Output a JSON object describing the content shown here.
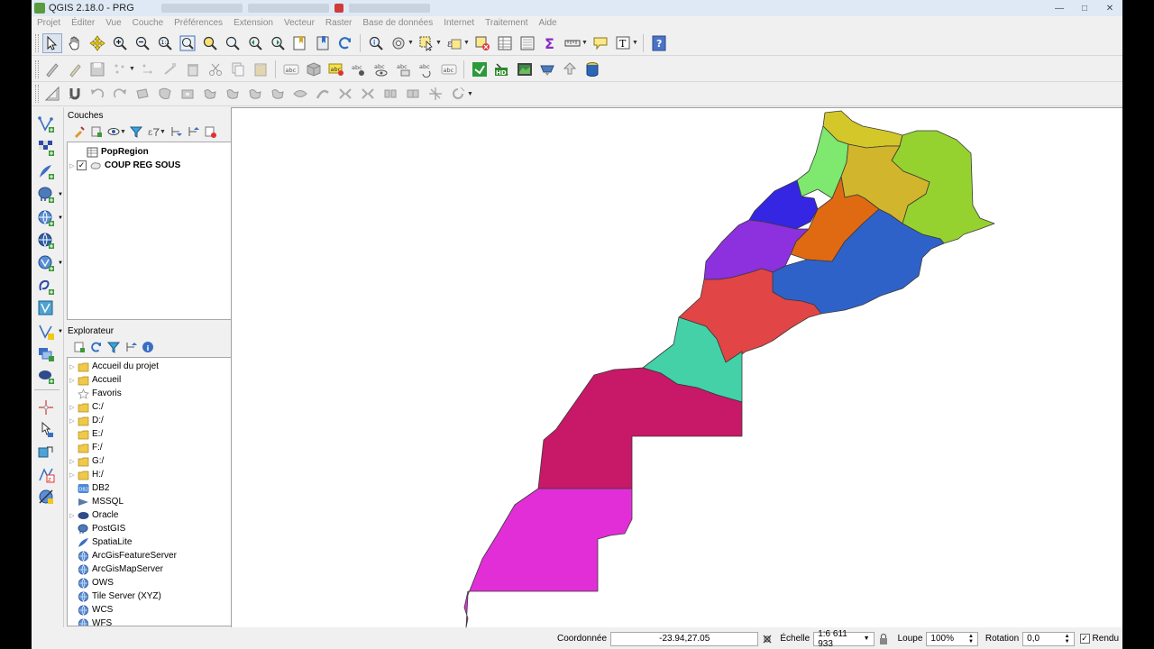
{
  "window": {
    "title": "QGIS 2.18.0 - PRG"
  },
  "menu": [
    "Projet",
    "Éditer",
    "Vue",
    "Couche",
    "Préférences",
    "Extension",
    "Vecteur",
    "Raster",
    "Base de données",
    "Internet",
    "Traitement",
    "Aide"
  ],
  "layers_panel": {
    "title": "Couches",
    "items": [
      {
        "label": "PopRegion",
        "checked": false,
        "type": "table"
      },
      {
        "label": "COUP REG SOUS",
        "checked": true,
        "type": "polygon"
      }
    ]
  },
  "browser_panel": {
    "title": "Explorateur",
    "items": [
      {
        "label": "Accueil du projet",
        "icon": "folder-icon",
        "expandable": true
      },
      {
        "label": "Accueil",
        "icon": "folder-icon",
        "expandable": true
      },
      {
        "label": "Favoris",
        "icon": "star-icon",
        "expandable": false
      },
      {
        "label": "C:/",
        "icon": "folder-icon",
        "expandable": true
      },
      {
        "label": "D:/",
        "icon": "folder-icon",
        "expandable": true
      },
      {
        "label": "E:/",
        "icon": "folder-icon",
        "expandable": false
      },
      {
        "label": "F:/",
        "icon": "folder-icon",
        "expandable": false
      },
      {
        "label": "G:/",
        "icon": "folder-icon",
        "expandable": true
      },
      {
        "label": "H:/",
        "icon": "folder-icon",
        "expandable": true
      },
      {
        "label": "DB2",
        "icon": "db2-icon",
        "expandable": false
      },
      {
        "label": "MSSQL",
        "icon": "mssql-icon",
        "expandable": false
      },
      {
        "label": "Oracle",
        "icon": "oracle-icon",
        "expandable": true
      },
      {
        "label": "PostGIS",
        "icon": "postgis-icon",
        "expandable": false
      },
      {
        "label": "SpatiaLite",
        "icon": "spatialite-icon",
        "expandable": false
      },
      {
        "label": "ArcGisFeatureServer",
        "icon": "globe-icon",
        "expandable": false
      },
      {
        "label": "ArcGisMapServer",
        "icon": "globe-icon",
        "expandable": false
      },
      {
        "label": "OWS",
        "icon": "globe-icon",
        "expandable": false
      },
      {
        "label": "Tile Server (XYZ)",
        "icon": "globe-icon",
        "expandable": false
      },
      {
        "label": "WCS",
        "icon": "globe-icon",
        "expandable": false
      },
      {
        "label": "WFS",
        "icon": "globe-icon",
        "expandable": false
      }
    ]
  },
  "map": {
    "region_colors": [
      "#d3c72a",
      "#96d22f",
      "#7ee86f",
      "#d1b52c",
      "#3426e3",
      "#e06a12",
      "#8d30de",
      "#2f62c9",
      "#e14545",
      "#44d1a8",
      "#c81868",
      "#e22ed7"
    ]
  },
  "status": {
    "coord_label": "Coordonnée",
    "coord_value": "-23.94,27.05",
    "scale_label": "Échelle",
    "scale_value": "1:6 611 933",
    "magnifier_label": "Loupe",
    "magnifier_value": "100%",
    "rotation_label": "Rotation",
    "rotation_value": "0,0",
    "render_label": "Rendu",
    "render_checked": true
  }
}
